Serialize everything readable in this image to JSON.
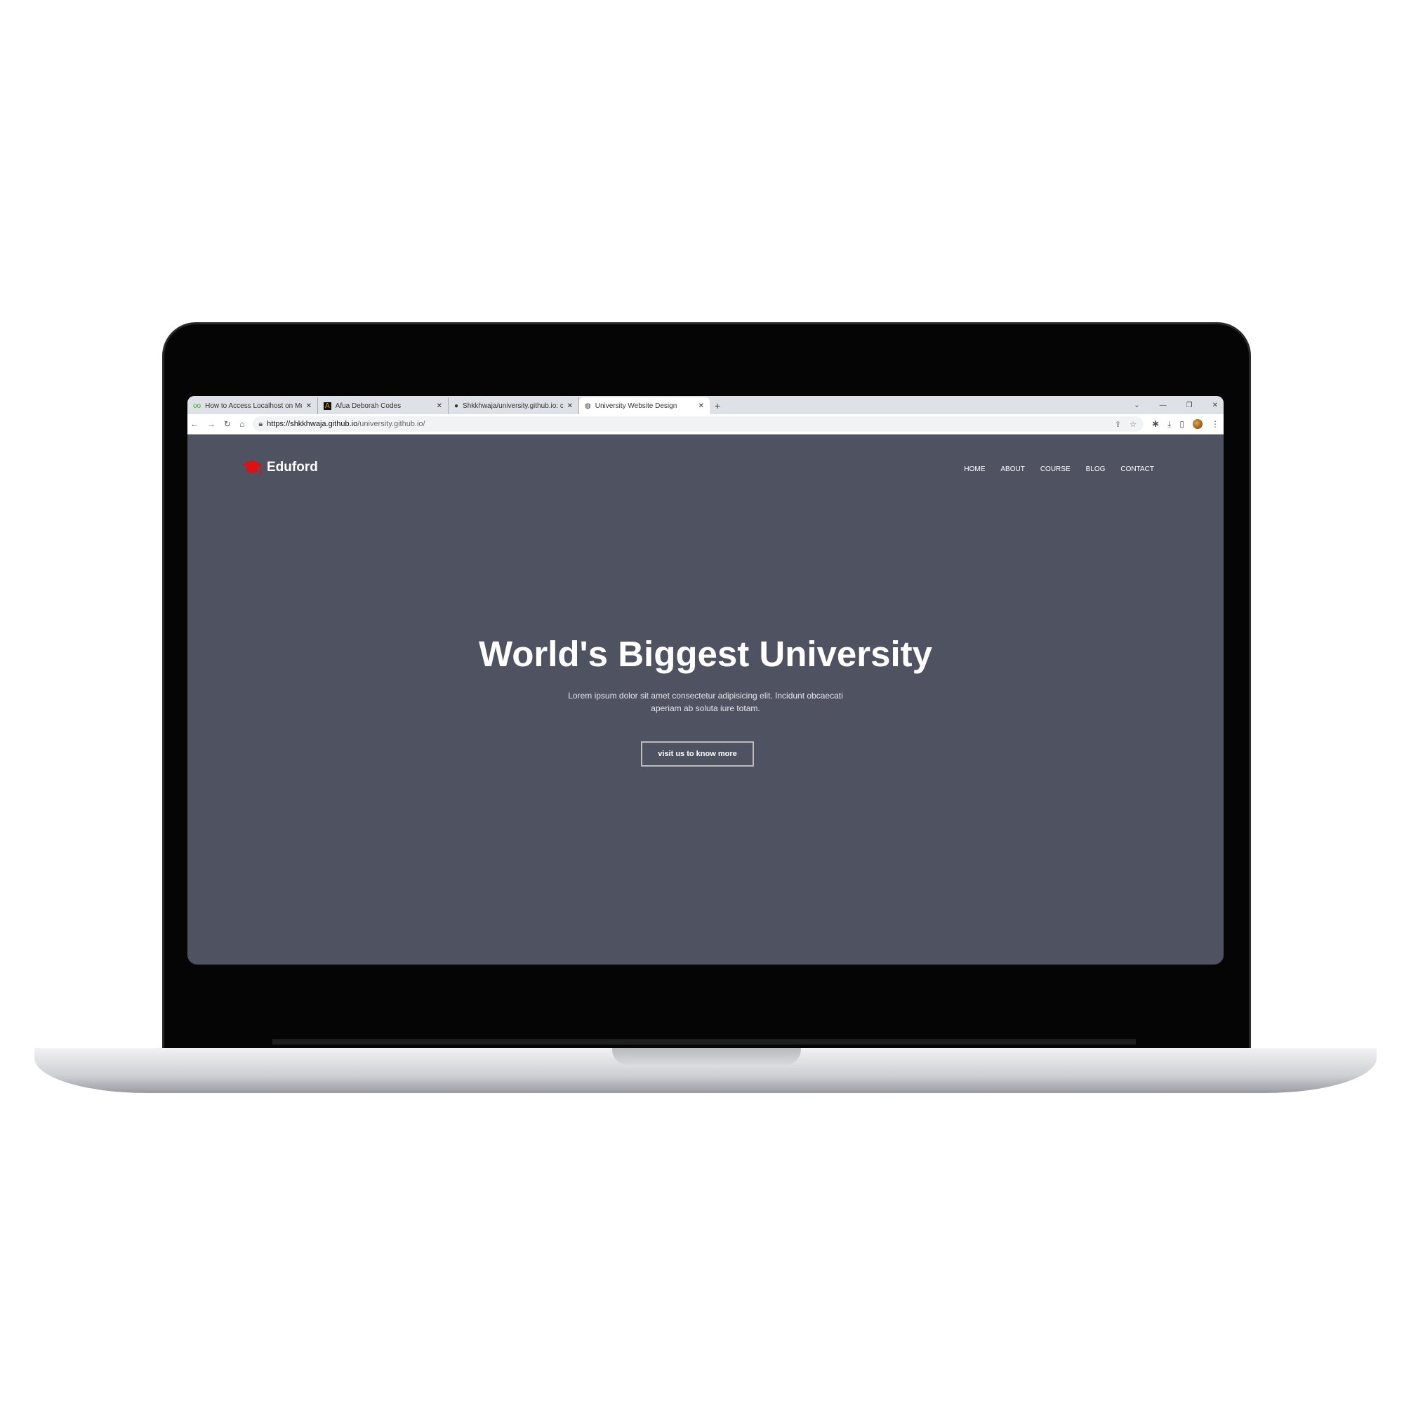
{
  "browser": {
    "tabs": [
      {
        "title": "How to Access Localhost on Mo",
        "icon": "gg-favicon"
      },
      {
        "title": "Afua Deborah Codes",
        "icon": "a-favicon"
      },
      {
        "title": "Shkkhwaja/university.github.io: c",
        "icon": "github-icon"
      },
      {
        "title": "University Website Design",
        "icon": "globe-icon",
        "active": true
      }
    ],
    "new_tab": "+",
    "url_host": "https://shkkhwaja.github.io",
    "url_path": "/university.github.io/"
  },
  "site": {
    "brand": "Eduford",
    "brand_color": "#e01010",
    "nav": [
      "HOME",
      "ABOUT",
      "COURSE",
      "BLOG",
      "CONTACT"
    ],
    "hero_title": "World's Biggest University",
    "hero_text": "Lorem ipsum dolor sit amet consectetur adipisicing elit. Incidunt obcaecati aperiam ab soluta iure totam.",
    "cta": "visit us to know more",
    "background": "#4f5261"
  }
}
